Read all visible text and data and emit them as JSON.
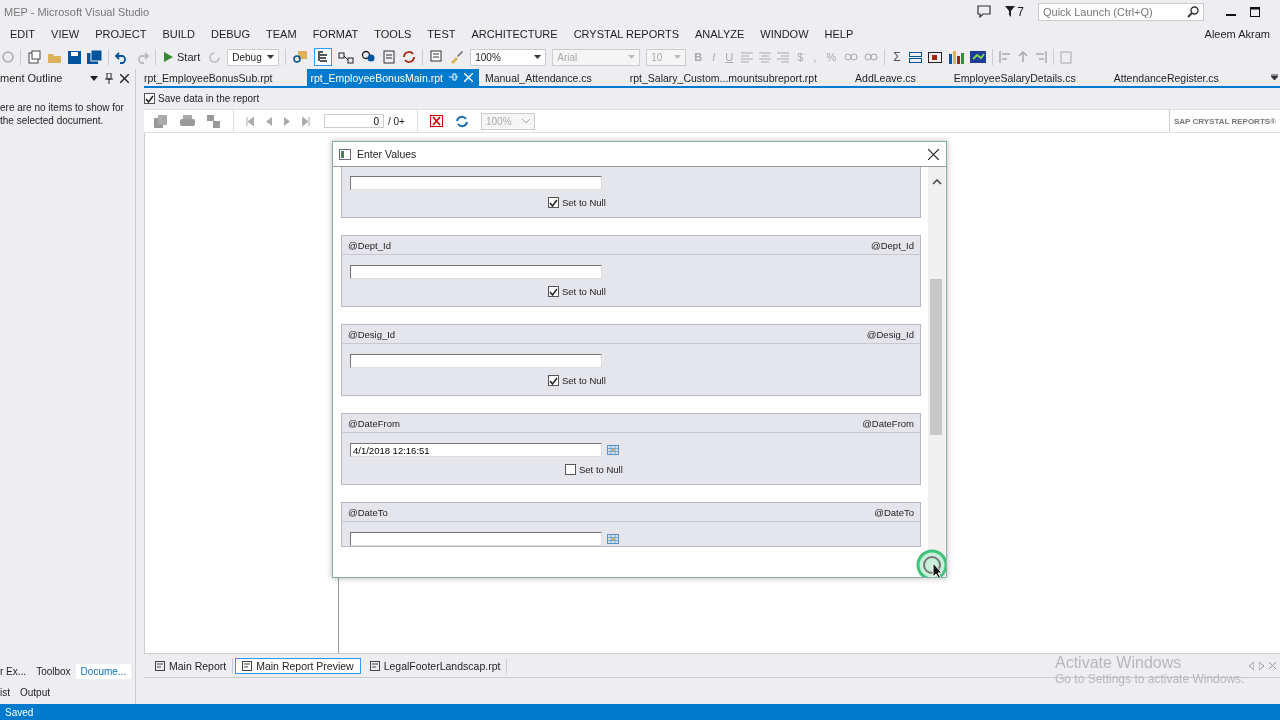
{
  "window": {
    "title": "MEP - Microsoft Visual Studio",
    "notification_count": "7",
    "quick_launch": {
      "placeholder": "Quick Launch (Ctrl+Q)"
    }
  },
  "menu": [
    "EDIT",
    "VIEW",
    "PROJECT",
    "BUILD",
    "DEBUG",
    "TEAM",
    "FORMAT",
    "TOOLS",
    "TEST",
    "ARCHITECTURE",
    "CRYSTAL REPORTS",
    "ANALYZE",
    "WINDOW",
    "HELP"
  ],
  "user": "Aleem Akram",
  "toolbar": {
    "start": "Start",
    "configuration": "Debug",
    "zoom": "100%",
    "font": "Arial",
    "font_size": "10",
    "format_buttons": [
      "B",
      "I",
      "U"
    ],
    "number_buttons": [
      "$",
      ",",
      "%"
    ],
    "sum_button": "Σ"
  },
  "left_panel": {
    "title": "ment Outline",
    "message": "ere are no items to show for the selected document.",
    "tabs": [
      {
        "label": "r Ex...",
        "selected": false
      },
      {
        "label": "Toolbox",
        "selected": false
      },
      {
        "label": "Docume...",
        "selected": true
      }
    ],
    "lower_tabs": [
      {
        "label": "ist",
        "selected": false
      },
      {
        "label": "Output",
        "selected": false
      }
    ]
  },
  "editor_tabs": [
    {
      "label": "rpt_EmployeeBonusSub.rpt",
      "selected": false
    },
    {
      "label": "rpt_EmployeeBonusMain.rpt",
      "selected": true
    },
    {
      "label": "Manual_Attendance.cs",
      "selected": false
    },
    {
      "label": "rpt_Salary_Custom...mountsubreport.rpt",
      "selected": false
    },
    {
      "label": "AddLeave.cs",
      "selected": false
    },
    {
      "label": "EmployeeSalaryDetails.cs",
      "selected": false
    },
    {
      "label": "AttendanceRegister.cs",
      "selected": false
    }
  ],
  "report_toolbar": {
    "save_data": {
      "label": "Save data in the report",
      "checked": true
    },
    "page": "0",
    "page_total": "/ 0+",
    "zoom": "100%",
    "brand": "SAP CRYSTAL REPORTS®"
  },
  "dialog": {
    "title": "Enter Values",
    "parameters": [
      {
        "checked": true,
        "null_label": "Set to Null",
        "calendar": false
      },
      {
        "label": "@Dept_Id",
        "name": "@Dept_Id",
        "checked": true,
        "null_label": "Set to Null",
        "calendar": false
      },
      {
        "label": "@Desig_Id",
        "name": "@Desig_Id",
        "checked": true,
        "null_label": "Set to Null",
        "calendar": false
      },
      {
        "label": "@DateFrom",
        "name": "@DateFrom",
        "value": "4/1/2018 12:16:51",
        "checked": false,
        "null_label": "Set to Null",
        "calendar": true
      },
      {
        "label": "@DateTo",
        "name": "@DateTo",
        "calendar": true
      }
    ]
  },
  "bottom_tabs": [
    {
      "label": "Main Report",
      "selected": false
    },
    {
      "label": "Main Report Preview",
      "selected": true
    },
    {
      "label": "LegalFooterLandscap.rpt",
      "selected": false
    }
  ],
  "activation": {
    "title": "Activate Windows",
    "subtitle": "Go to Settings to activate Windows."
  },
  "status_bar": "Saved"
}
